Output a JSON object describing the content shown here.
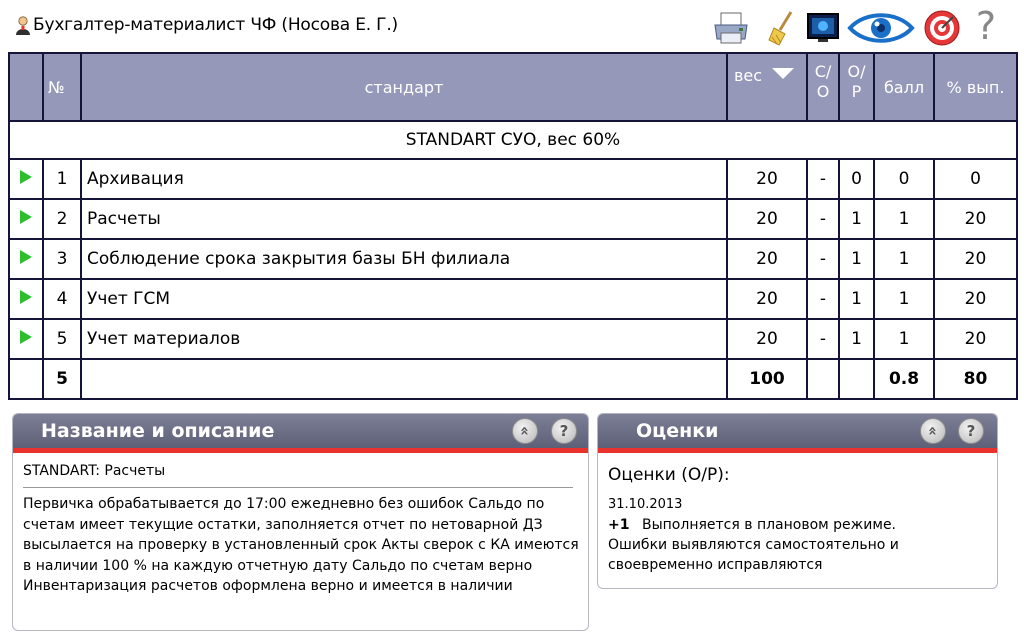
{
  "header": {
    "title": "Бухгалтер-материалист ЧФ   (Носова Е. Г.)",
    "icons": [
      "user-icon",
      "printer-icon",
      "broom-icon",
      "monitor-icon",
      "eye-icon",
      "target-icon",
      "help-icon"
    ],
    "help_label": "?"
  },
  "table": {
    "columns": {
      "num": "№",
      "standard": "стандарт",
      "weight": "вес",
      "so_top": "С/",
      "so_bottom": "О",
      "op_top": "О/",
      "op_bottom": "Р",
      "score": "балл",
      "percent": "% вып."
    },
    "section": "STANDART СУО, вес 60%",
    "rows": [
      {
        "num": "1",
        "name": "Архивация",
        "weight": "20",
        "so": "-",
        "op": "0",
        "score": "0",
        "percent": "0"
      },
      {
        "num": "2",
        "name": "Расчеты",
        "weight": "20",
        "so": "-",
        "op": "1",
        "score": "1",
        "percent": "20"
      },
      {
        "num": "3",
        "name": "Соблюдение срока закрытия базы БН филиала",
        "weight": "20",
        "so": "-",
        "op": "1",
        "score": "1",
        "percent": "20"
      },
      {
        "num": "4",
        "name": "Учет ГСМ",
        "weight": "20",
        "so": "-",
        "op": "1",
        "score": "1",
        "percent": "20"
      },
      {
        "num": "5",
        "name": "Учет материалов",
        "weight": "20",
        "so": "-",
        "op": "1",
        "score": "1",
        "percent": "20"
      }
    ],
    "total": {
      "num": "5",
      "weight": "100",
      "score": "0.8",
      "percent": "80"
    }
  },
  "panel_left": {
    "title": "Название и описание",
    "collapse_label": "«",
    "help_label": "?",
    "standard_name": "STANDART: Расчеты",
    "description": "Первичка обрабатывается до 17:00 ежедневно без ошибок Сальдо по счетам имеет текущие остатки, заполняется отчет по нетоварной ДЗ высылается на проверку в установленный срок Акты сверок с КА имеются в наличии 100 % на каждую отчетную дату Сальдо по счетам верно Инвентаризация расчетов оформлена верно и имеется в наличии"
  },
  "panel_right": {
    "title": "Оценки",
    "collapse_label": "«",
    "help_label": "?",
    "heading": "Оценки (О/Р):",
    "date": "31.10.2013",
    "score": "+1",
    "text": "Выполняется в плановом режиме.\nОшибки выявляются  самостоятельно и своевременно исправляются"
  },
  "colors": {
    "header_bg": "#9598b9",
    "border": "#14143a",
    "total_bg": "#e0e0e0",
    "panel_head": "#6e7088",
    "accent_red": "#e8322e",
    "play_green": "#2dbf2d"
  }
}
